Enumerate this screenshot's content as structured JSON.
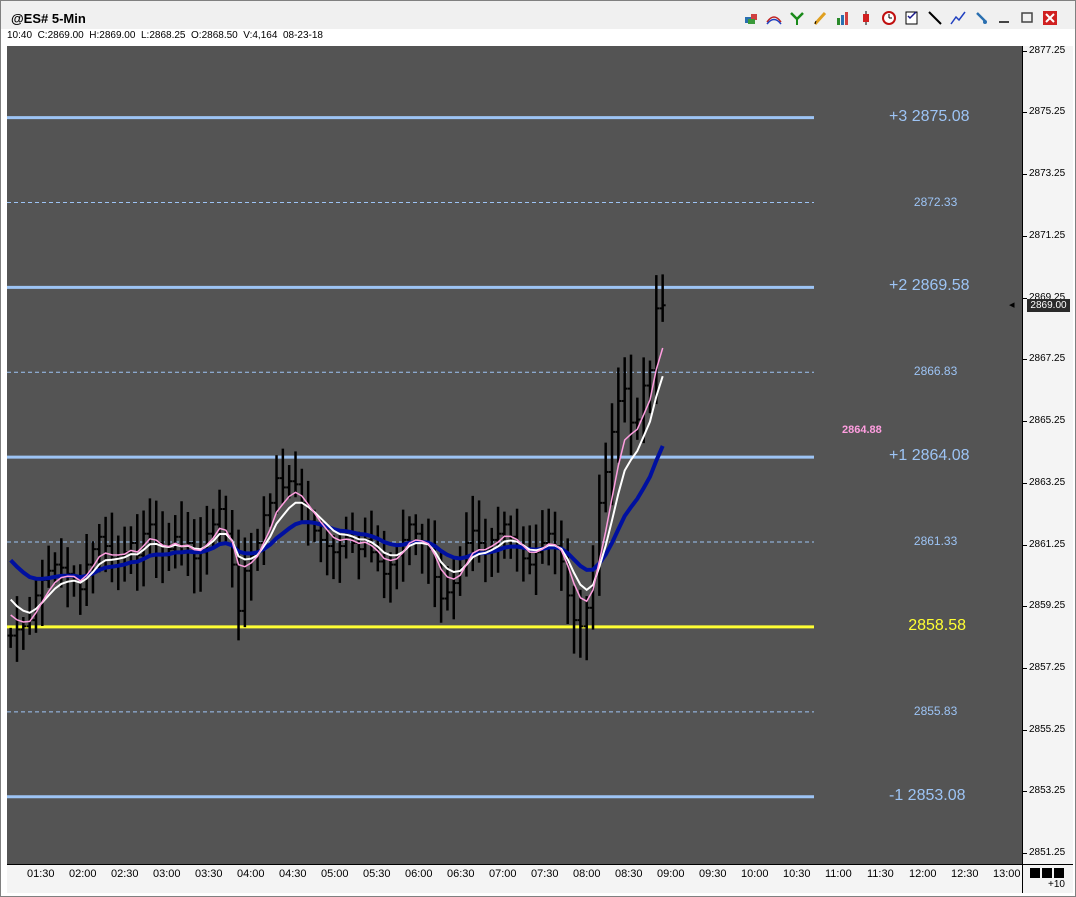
{
  "window": {
    "title": "@ES# 5-Min",
    "quote_line": "10:40  C:2869.00  H:2869.00  L:2868.25  O:2868.50  V:4,164  08-23-18",
    "last_price": "2869.00",
    "zoom_label": "+10",
    "toolbar_icons": [
      "stack-icon",
      "bands-icon",
      "tree-icon",
      "pencil-icon",
      "bar-chart-icon",
      "candlestick-icon",
      "clock-icon",
      "checklist-icon",
      "line-tool-icon",
      "trend-icon",
      "pin-icon",
      "minimize-icon",
      "restore-icon",
      "close-icon"
    ]
  },
  "levels": [
    {
      "price": 2875.08,
      "label": "+3 2875.08",
      "kind": "main"
    },
    {
      "price": 2872.33,
      "label": "2872.33",
      "kind": "half"
    },
    {
      "price": 2869.58,
      "label": "+2 2869.58",
      "kind": "main"
    },
    {
      "price": 2866.83,
      "label": "2866.83",
      "kind": "half"
    },
    {
      "price": 2864.08,
      "label": "+1 2864.08",
      "kind": "main"
    },
    {
      "price": 2861.33,
      "label": "2861.33",
      "kind": "half"
    },
    {
      "price": 2858.58,
      "label": "2858.58",
      "kind": "base"
    },
    {
      "price": 2855.83,
      "label": "2855.83",
      "kind": "half"
    },
    {
      "price": 2853.08,
      "label": "-1 2853.08",
      "kind": "main"
    }
  ],
  "ma_label": "2864.88",
  "colors": {
    "background": "#545454",
    "level_line": "#9dc4f5",
    "base_line": "#ffff33",
    "bars": "#000000",
    "ma_pink": "#ff9ee0",
    "ma_white": "#ffffff",
    "ma_blue": "#0010a0"
  },
  "chart_data": {
    "type": "line",
    "title": "@ES# 5-Min",
    "xlabel": "",
    "ylabel": "",
    "x_ticks": [
      "01:30",
      "02:00",
      "02:30",
      "03:00",
      "03:30",
      "04:00",
      "04:30",
      "05:00",
      "05:30",
      "06:00",
      "06:30",
      "07:00",
      "07:30",
      "08:00",
      "08:30",
      "09:00",
      "09:30",
      "10:00",
      "10:30",
      "11:00",
      "11:30",
      "12:00",
      "12:30",
      "13:00"
    ],
    "y_ticks": [
      "2877.25",
      "2875.25",
      "2873.25",
      "2871.25",
      "2869.25",
      "2867.25",
      "2865.25",
      "2863.25",
      "2861.25",
      "2859.25",
      "2857.25",
      "2855.25",
      "2853.25",
      "2851.25"
    ],
    "ylim": [
      2850.9,
      2877.4
    ],
    "grid": false,
    "closes": [
      2858.3,
      2858.5,
      2858.6,
      2858.8,
      2859.6,
      2860.1,
      2860.4,
      2860.6,
      2860.5,
      2860.3,
      2860.2,
      2859.8,
      2860.6,
      2861.1,
      2861.5,
      2861.2,
      2860.8,
      2860.9,
      2861.0,
      2861.3,
      2860.9,
      2861.6,
      2861.9,
      2861.3,
      2860.9,
      2861.1,
      2861.5,
      2861.0,
      2861.3,
      2860.8,
      2861.0,
      2861.6,
      2861.9,
      2862.4,
      2861.6,
      2860.6,
      2859.1,
      2860.4,
      2860.9,
      2861.3,
      2862.2,
      2862.6,
      2863.4,
      2863.1,
      2863.3,
      2863.2,
      2862.6,
      2862.0,
      2861.7,
      2861.4,
      2861.2,
      2861.0,
      2861.2,
      2861.5,
      2861.3,
      2861.1,
      2861.4,
      2861.0,
      2860.7,
      2860.3,
      2860.6,
      2860.9,
      2861.4,
      2861.9,
      2861.6,
      2861.3,
      2861.1,
      2860.2,
      2859.5,
      2859.7,
      2860.0,
      2860.5,
      2861.3,
      2861.7,
      2861.3,
      2861.1,
      2861.4,
      2861.6,
      2861.9,
      2861.5,
      2861.2,
      2860.8,
      2860.6,
      2861.0,
      2861.3,
      2861.6,
      2861.2,
      2860.7,
      2859.6,
      2858.8,
      2858.6,
      2859.2,
      2860.5,
      2862.6,
      2863.6,
      2864.9,
      2865.9,
      2866.3,
      2865.2,
      2865.3,
      2866.4,
      2866.9,
      2868.9,
      2869.0
    ]
  }
}
